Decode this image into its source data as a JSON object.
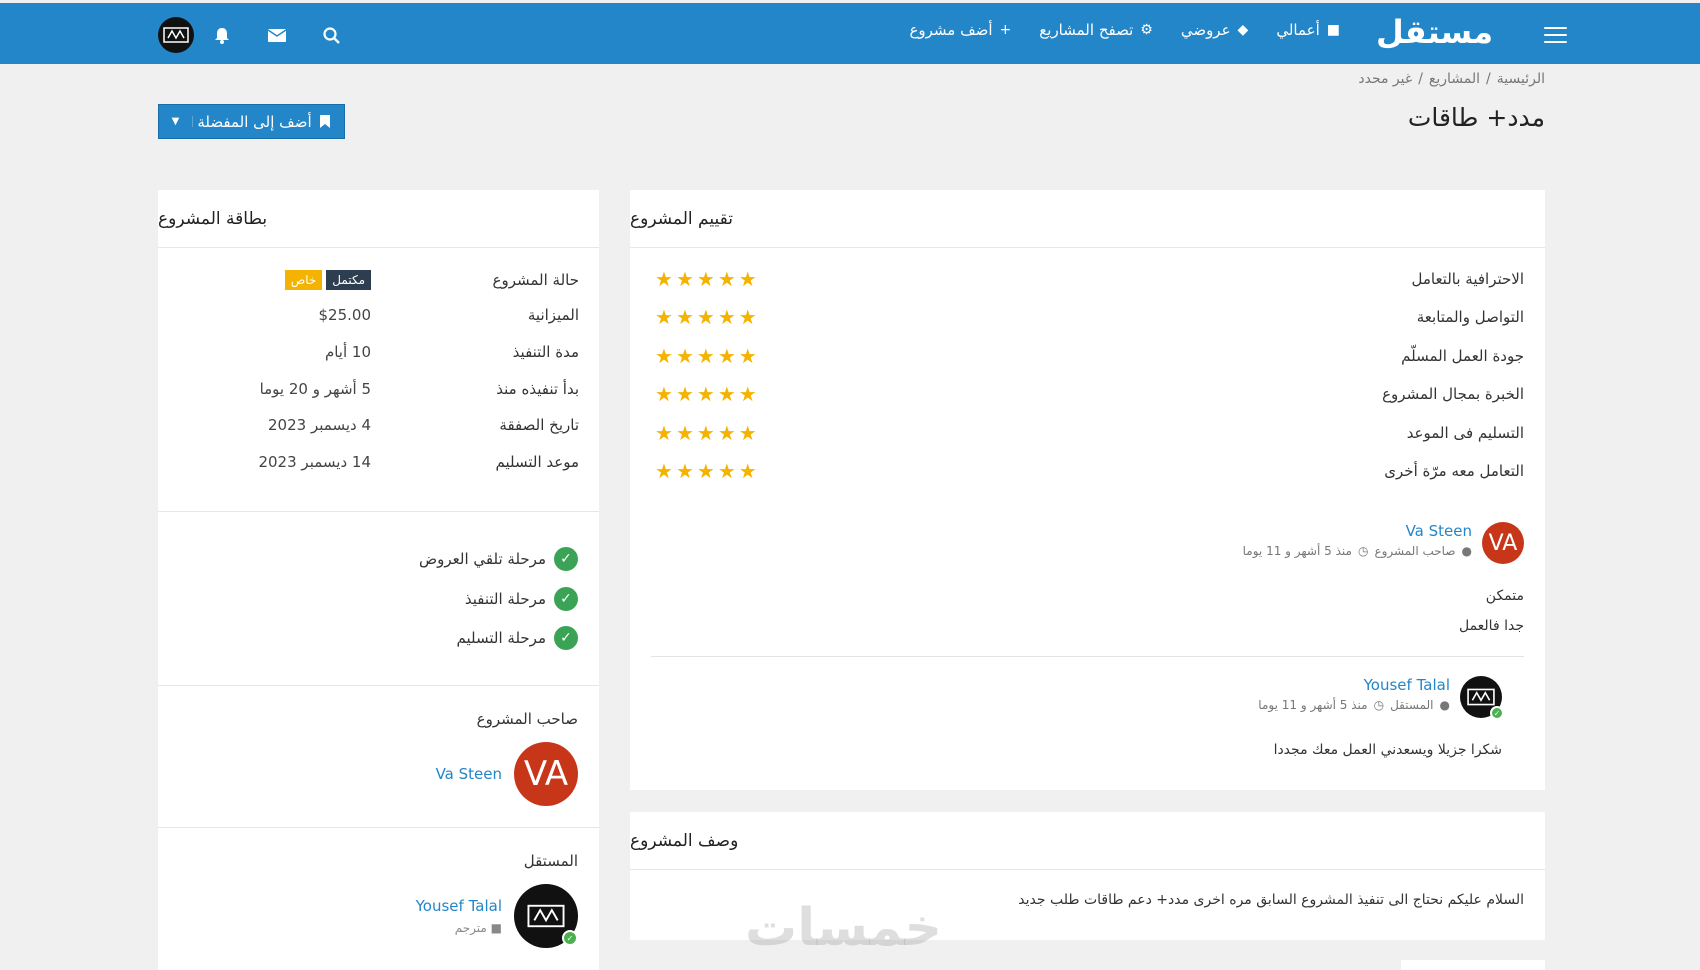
{
  "nav": {
    "brand": "مستقل",
    "items": [
      {
        "label": "أضف مشروع",
        "icon": "+"
      },
      {
        "label": "تصفح المشاريع",
        "icon": "⚙"
      },
      {
        "label": "عروضي",
        "icon": "🏷"
      },
      {
        "label": "أعمالي",
        "icon": "💼"
      }
    ]
  },
  "breadcrumb": [
    "الرئيسية",
    "المشاريع",
    "غير محدد"
  ],
  "breadcrumb_sep": "/",
  "page_title": "مدد+ طاقات",
  "favorite_button": "أضف إلى المفضلة",
  "rating": {
    "title": "تقييم المشروع",
    "rows": [
      {
        "label": "الاحترافية بالتعامل",
        "stars": 5
      },
      {
        "label": "التواصل والمتابعة",
        "stars": 5
      },
      {
        "label": "جودة العمل المسلّم",
        "stars": 5
      },
      {
        "label": "الخبرة بمجال المشروع",
        "stars": 5
      },
      {
        "label": "التسليم فى الموعد",
        "stars": 5
      },
      {
        "label": "التعامل معه مرّة أخرى",
        "stars": 5
      }
    ],
    "owner_comment": {
      "avatar_text": "VA",
      "name": "Va Steen",
      "role": "صاحب المشروع",
      "time": "منذ 5 أشهر و 11 يوما",
      "line1": "متمكن",
      "line2": "جدا فالعمل"
    },
    "freelancer_reply": {
      "name": "Yousef Talal",
      "role": "المستقل",
      "time": "منذ 5 أشهر و 11 يوما",
      "text": "شكرا جزيلا ويسعدني العمل معك مجددا"
    }
  },
  "description": {
    "title": "وصف المشروع",
    "text": "السلام عليكم نحتاج الى تنفيذ المشروع السابق مره اخرى مدد+ دعم طاقات طلب جديد"
  },
  "card": {
    "title": "بطاقة المشروع",
    "status_label": "حالة المشروع",
    "status_badges": [
      "مكتمل",
      "خاص"
    ],
    "rows": [
      {
        "label": "الميزانية",
        "value": "$25.00"
      },
      {
        "label": "مدة التنفيذ",
        "value": "10 أيام"
      },
      {
        "label": "بدأ تنفيذه منذ",
        "value": "5 أشهر و 20 يوما"
      },
      {
        "label": "تاريخ الصفقة",
        "value": "4 ديسمبر 2023"
      },
      {
        "label": "موعد التسليم",
        "value": "14 ديسمبر 2023"
      }
    ],
    "stages": [
      "مرحلة تلقي العروض",
      "مرحلة التنفيذ",
      "مرحلة التسليم"
    ],
    "owner_title": "صاحب المشروع",
    "owner_name": "Va Steen",
    "owner_avatar": "VA",
    "freelancer_title": "المستقل",
    "freelancer_name": "Yousef Talal",
    "freelancer_role": "مترجم"
  },
  "watermark": "خمسات",
  "colors": {
    "primary": "#2386c8",
    "star": "#f5b301",
    "owner_avatar": "#c8361a",
    "success": "#3aa356"
  }
}
